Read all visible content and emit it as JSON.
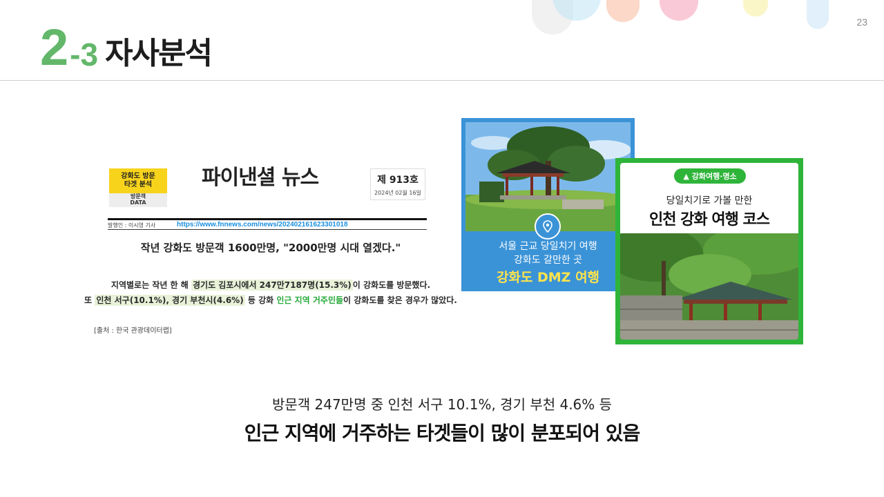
{
  "header": {
    "section_number": "2",
    "section_sub": "-3",
    "section_title": "자사분석",
    "page_number": "23",
    "accent_color": "#63b76a"
  },
  "news": {
    "tag_line1": "강화도 방문",
    "tag_line2": "타겟 분석",
    "tag_line3": "방문객",
    "tag_line4": "DATA",
    "paper_name": "파이낸셜 뉴스",
    "issue_number": "제 913호",
    "issue_date": "2024년 02월 16일",
    "reporter": "발행인 : 이시영 기사",
    "url": "https://www.fnnews.com/news/202402161623301018",
    "headline": "작년 강화도 방문객 1600만명, \"2000만명 시대 열겠다.\"",
    "line1_a": "지역별로는 작년 한 해 ",
    "line1_hl": "경기도 김포시에서 247만7187명(15.3%)",
    "line1_b": "이 강화도를 방문했다.",
    "line2_a": "또 ",
    "line2_hl": "인천 서구(10.1%), 경기 부천시(4.6%)",
    "line2_b": " 등 강화 ",
    "line2_green": "인근 지역 거주민들",
    "line2_c": "이 강화도를 찾은 경우가 많았다.",
    "source": "[출처 : 한국 관광데이터랩]"
  },
  "card1": {
    "line1": "서울 근교 당일치기 여행",
    "line2": "강화도 갈만한 곳",
    "line3": "강화도 DMZ 여행",
    "bg_color": "#3b93d7",
    "highlight_color": "#ffe44a"
  },
  "card2": {
    "badge": "강화여행·명소",
    "subtitle": "당일치기로 가볼 만한",
    "title": "인천 강화 여행 코스",
    "bg_color": "#2fb43a"
  },
  "summary": {
    "line1": "방문객 247만명 중 인천 서구 10.1%, 경기 부천 4.6% 등",
    "line2": "인근 지역에 거주하는 타겟들이 많이 분포되어 있음"
  }
}
